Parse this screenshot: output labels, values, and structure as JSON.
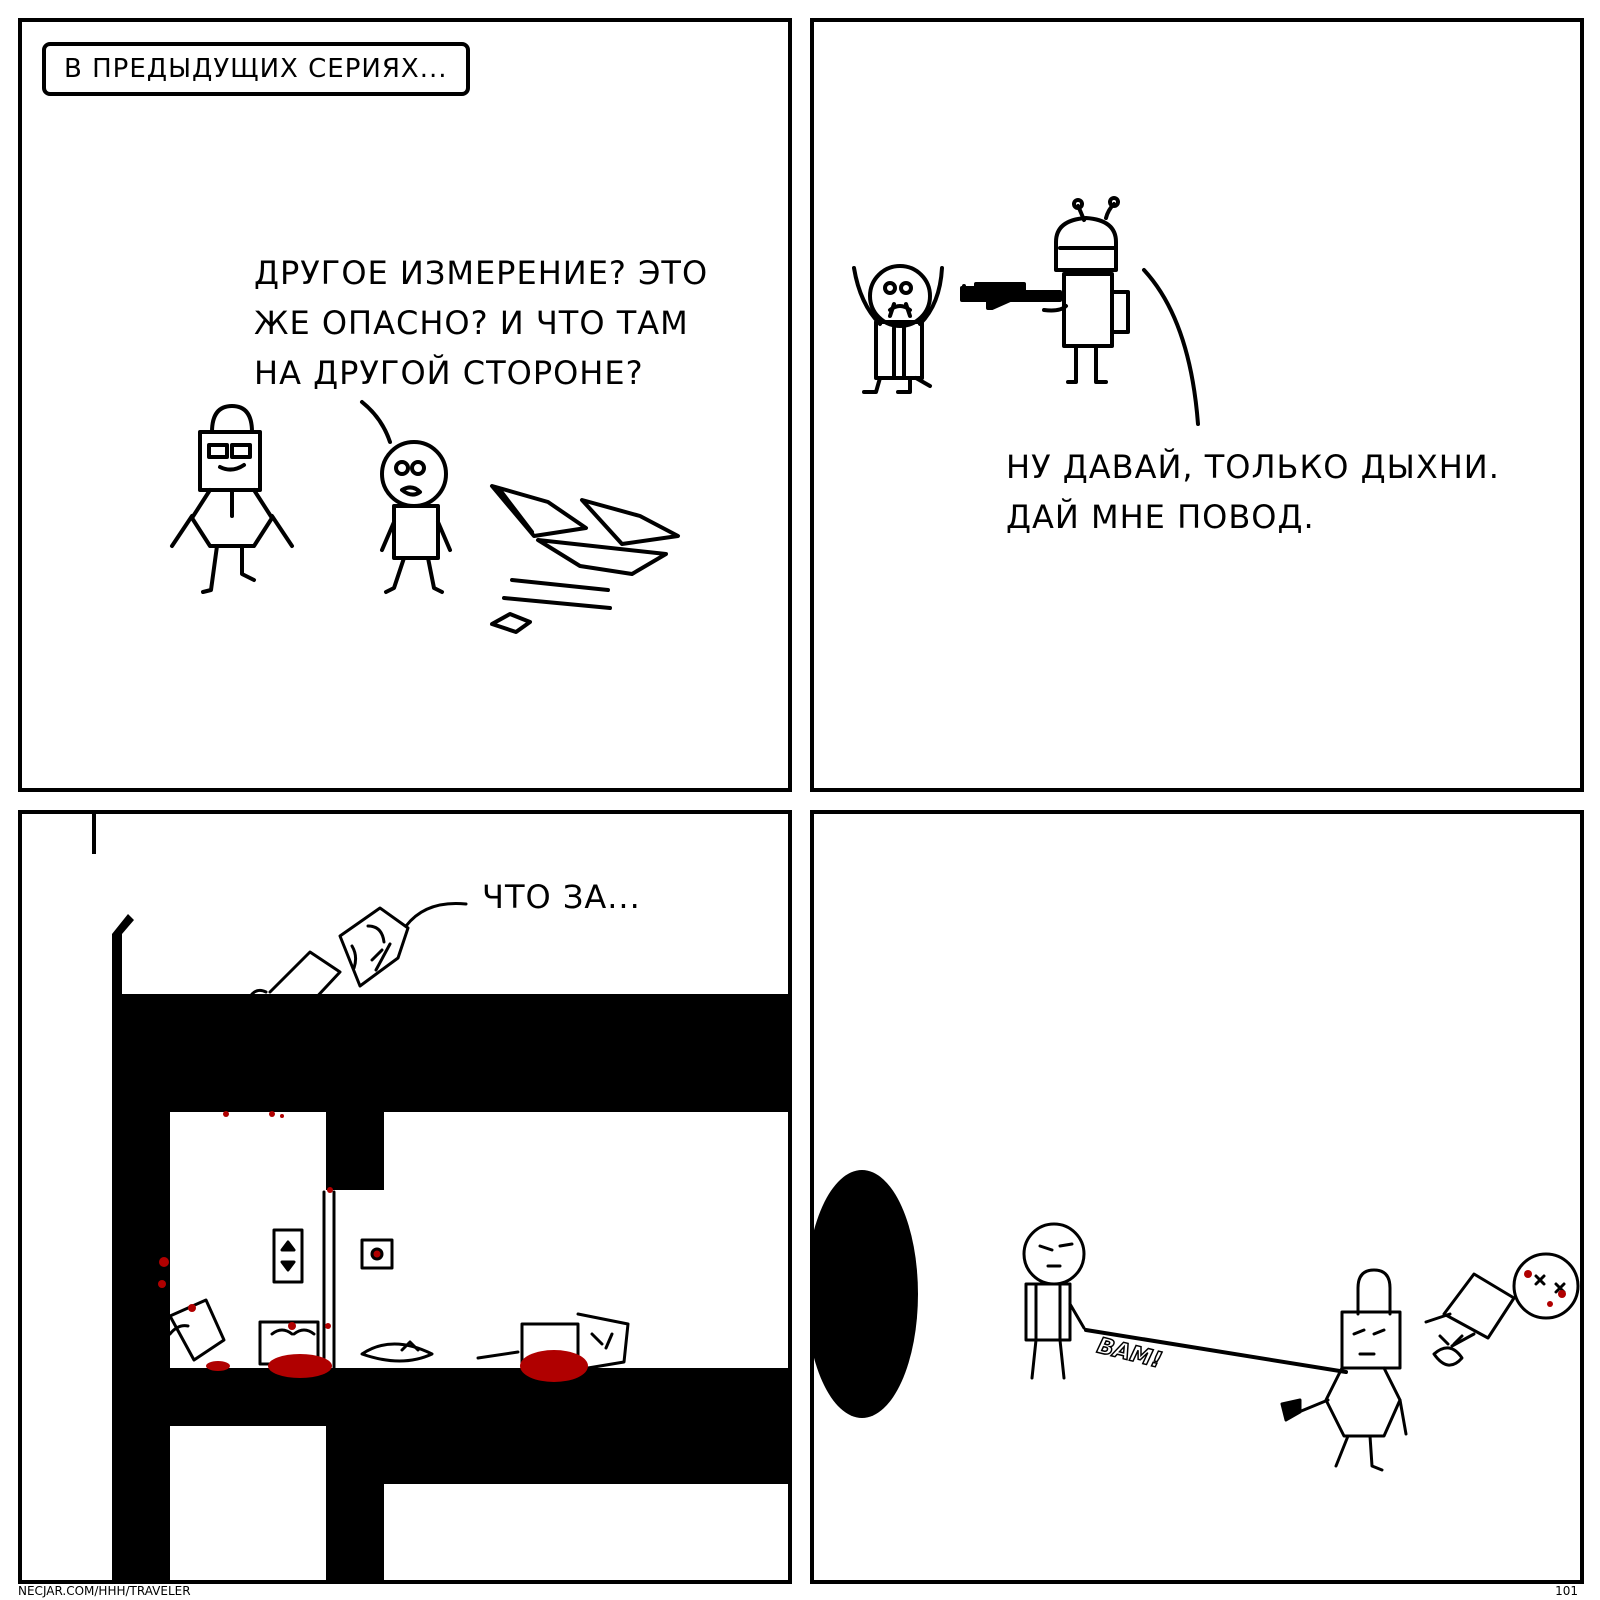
{
  "panels": [
    {
      "caption": "В ПРЕДЫДУЩИХ СЕРИЯХ...",
      "speech_lines": [
        "ДРУГОЕ ИЗМЕРЕНИЕ? ЭТО",
        "ЖЕ ОПАСНО? И ЧТО ТАМ",
        "НА ДРУГОЙ СТОРОНЕ?"
      ]
    },
    {
      "speech_lines": [
        "НУ ДАВАЙ, ТОЛЬКО ДЫХНИ.",
        "ДАЙ МНЕ ПОВОД."
      ]
    },
    {
      "speech": "ЧТО ЗА..."
    },
    {
      "sfx": "BAM!"
    }
  ],
  "footer": {
    "credit": "NECJAR.COM/HHH/TRAVELER",
    "page": "101"
  },
  "colors": {
    "ink": "#000000",
    "blood": "#b00000",
    "paper": "#ffffff"
  }
}
